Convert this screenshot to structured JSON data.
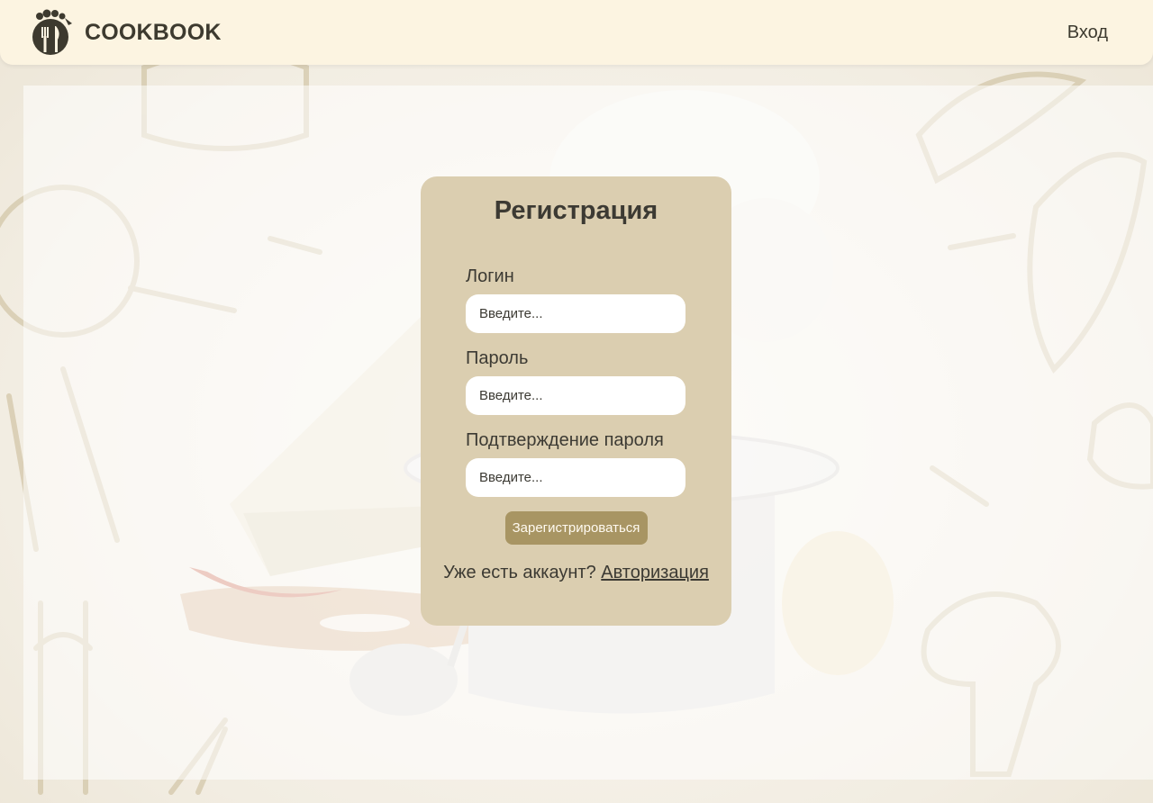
{
  "header": {
    "brand": "COOKBOOK",
    "login_label": "Вход"
  },
  "form": {
    "title": "Регистрация",
    "fields": [
      {
        "label": "Логин",
        "placeholder": "Введите..."
      },
      {
        "label": "Пароль",
        "placeholder": "Введите..."
      },
      {
        "label": "Подтверждение пароля",
        "placeholder": "Введите..."
      }
    ],
    "submit_label": "Зарегистрироваться",
    "have_account_text": "Уже есть аккаунт?",
    "auth_link_label": "Авторизация"
  },
  "icons": {
    "logo": "chef-hat-cutlery-logo-icon"
  },
  "colors": {
    "header_bg": "#fcf4e1",
    "card_bg": "#dbceb0",
    "button_bg": "#a89563",
    "text_dark": "#3c3a33"
  }
}
